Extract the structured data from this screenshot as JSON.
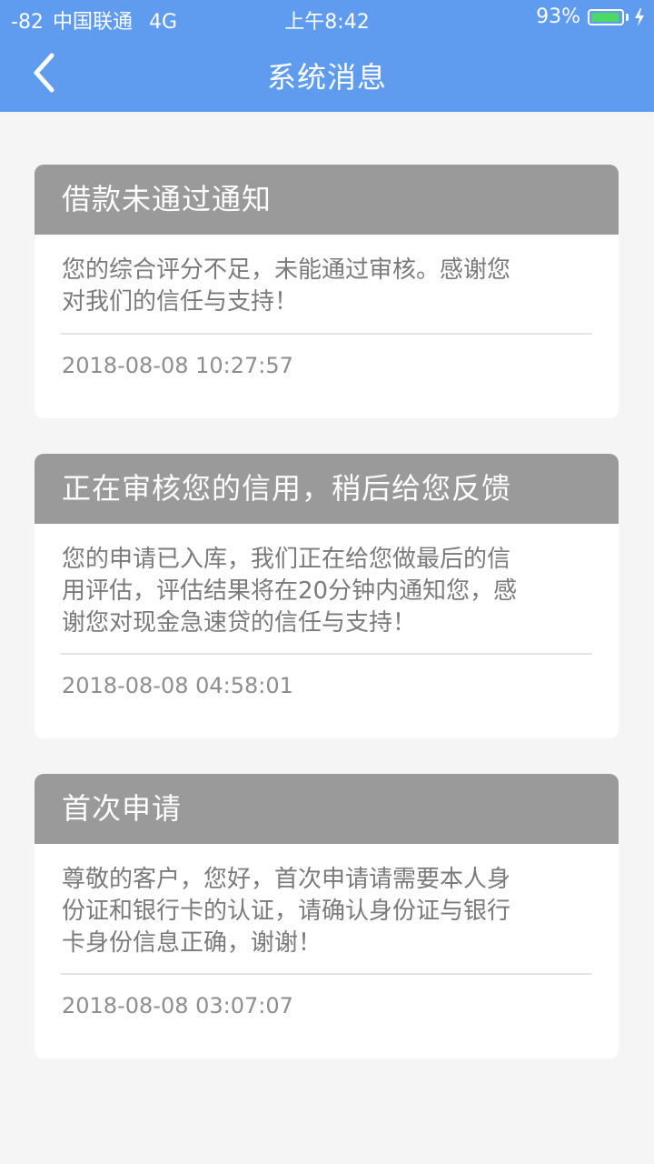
{
  "status_bar": {
    "signal": "-82",
    "carrier": "中国联通",
    "network": "4G",
    "time": "上午8:42",
    "battery_percent": "93%",
    "battery_level": 0.93
  },
  "nav": {
    "title": "系统消息",
    "back_icon": "chevron-left-icon"
  },
  "messages": [
    {
      "title": "借款未通过通知",
      "lines": [
        "您的综合评分不足，未能通过审核。感谢您",
        "对我们的信任与支持！"
      ],
      "time": "2018-08-08 10:27:57"
    },
    {
      "title": "正在审核您的信用，稍后给您反馈",
      "lines": [
        "您的申请已入库，我们正在给您做最后的信",
        "用评估，评估结果将在20分钟内通知您，感",
        "谢您对现金急速贷的信任与支持！"
      ],
      "time": "2018-08-08 04:58:01"
    },
    {
      "title": "首次申请",
      "lines": [
        "尊敬的客户，您好，首次申请请需要本人身",
        "份证和银行卡的认证，请确认身份证与银行",
        "卡身份信息正确，谢谢！"
      ],
      "time": "2018-08-08 03:07:07"
    }
  ],
  "colors": {
    "header_blue": "#5f9bef",
    "card_header_gray": "#9a9a9a",
    "background": "#f5f5f5",
    "battery_green": "#4cd964"
  }
}
